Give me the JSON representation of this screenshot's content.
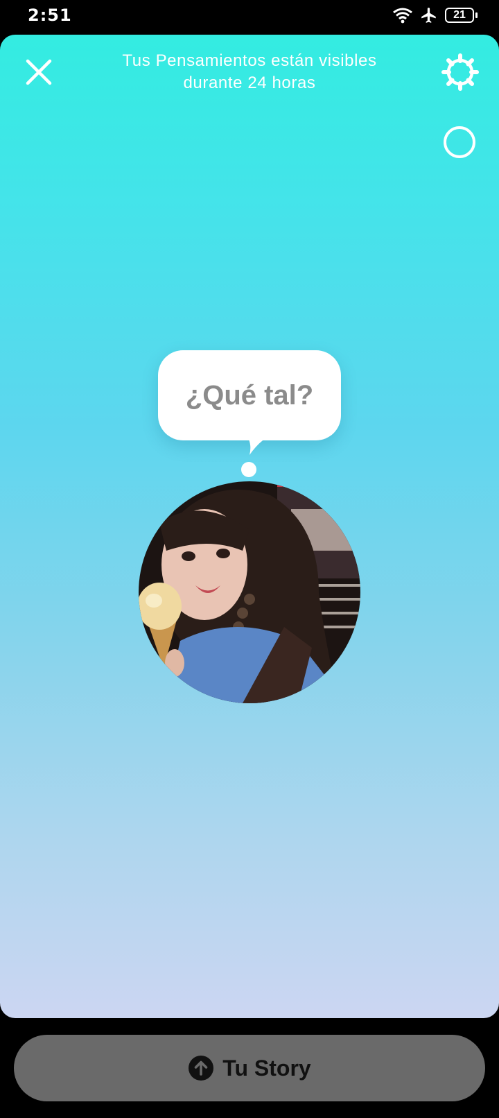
{
  "status_bar": {
    "time": "2:51",
    "battery": "21",
    "icons": [
      "wifi-icon",
      "airplane-mode-icon",
      "battery-icon"
    ]
  },
  "header": {
    "line1": "Tus Pensamientos están visibles",
    "line2": "durante 24 horas",
    "close_icon": "close-icon",
    "settings_icon": "gear-icon",
    "circle_icon": "circle-icon"
  },
  "bubble": {
    "placeholder": "¿Qué tal?"
  },
  "avatar": {
    "icon": "profile-photo"
  },
  "footer": {
    "story_label": "Tu Story",
    "story_icon": "arrow-up-circle-icon"
  },
  "colors": {
    "gradient_top": "#33ece1",
    "gradient_bottom": "#ccd6f2",
    "button_bg": "#6a6a6a"
  }
}
